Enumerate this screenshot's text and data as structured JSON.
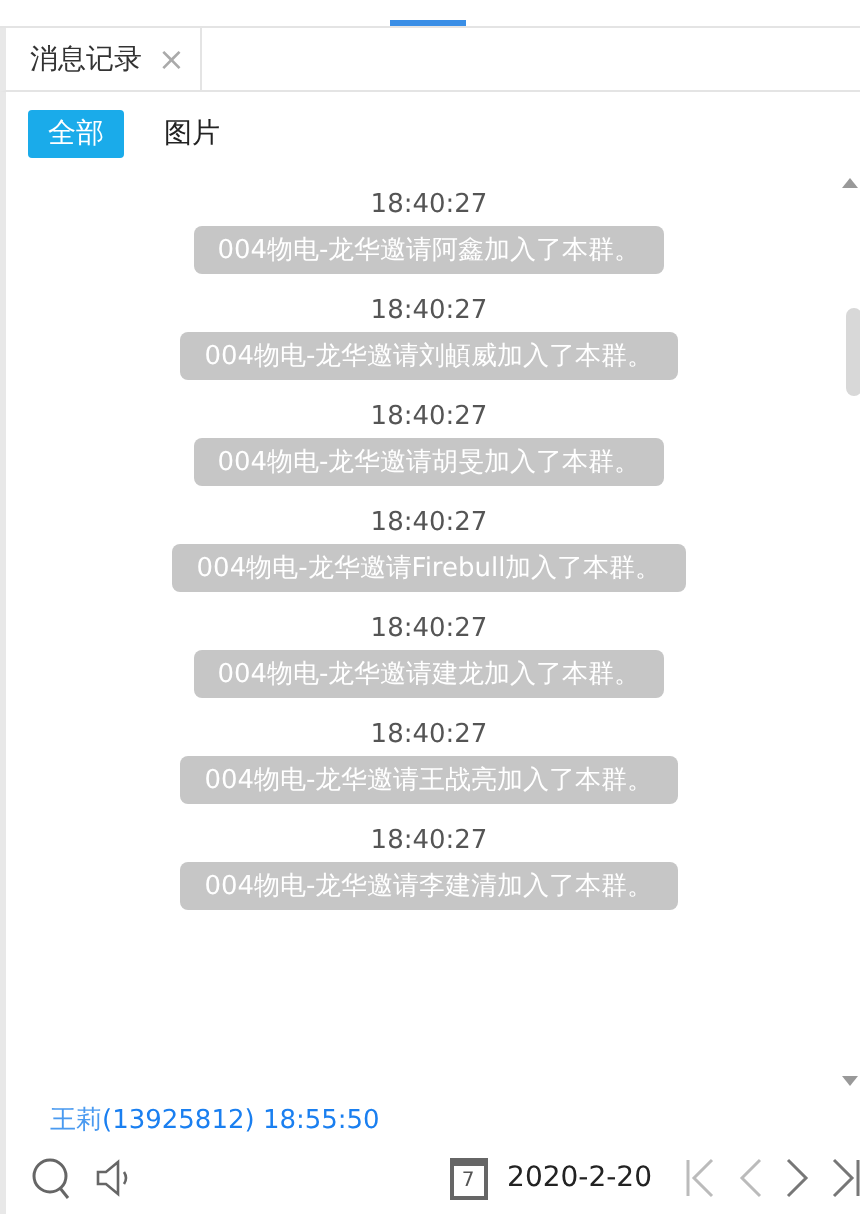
{
  "tab": {
    "title": "消息记录",
    "close": "×"
  },
  "filters": [
    {
      "label": "全部",
      "selected": true
    },
    {
      "label": "图片",
      "selected": false
    }
  ],
  "messages": [
    {
      "time": "18:40:27",
      "text": "004物电-龙华邀请阿鑫加入了本群。"
    },
    {
      "time": "18:40:27",
      "text": "004物电-龙华邀请刘頔威加入了本群。"
    },
    {
      "time": "18:40:27",
      "text": "004物电-龙华邀请胡旻加入了本群。"
    },
    {
      "time": "18:40:27",
      "text": "004物电-龙华邀请Firebull加入了本群。"
    },
    {
      "time": "18:40:27",
      "text": "004物电-龙华邀请建龙加入了本群。"
    },
    {
      "time": "18:40:27",
      "text": "004物电-龙华邀请王战亮加入了本群。"
    },
    {
      "time": "18:40:27",
      "text": "004物电-龙华邀请李建清加入了本群。"
    }
  ],
  "last_sender": {
    "name": "王莉",
    "id": "(13925812) 18:55:50"
  },
  "footer": {
    "date": "2020-2-20",
    "calendar_day": "7"
  }
}
